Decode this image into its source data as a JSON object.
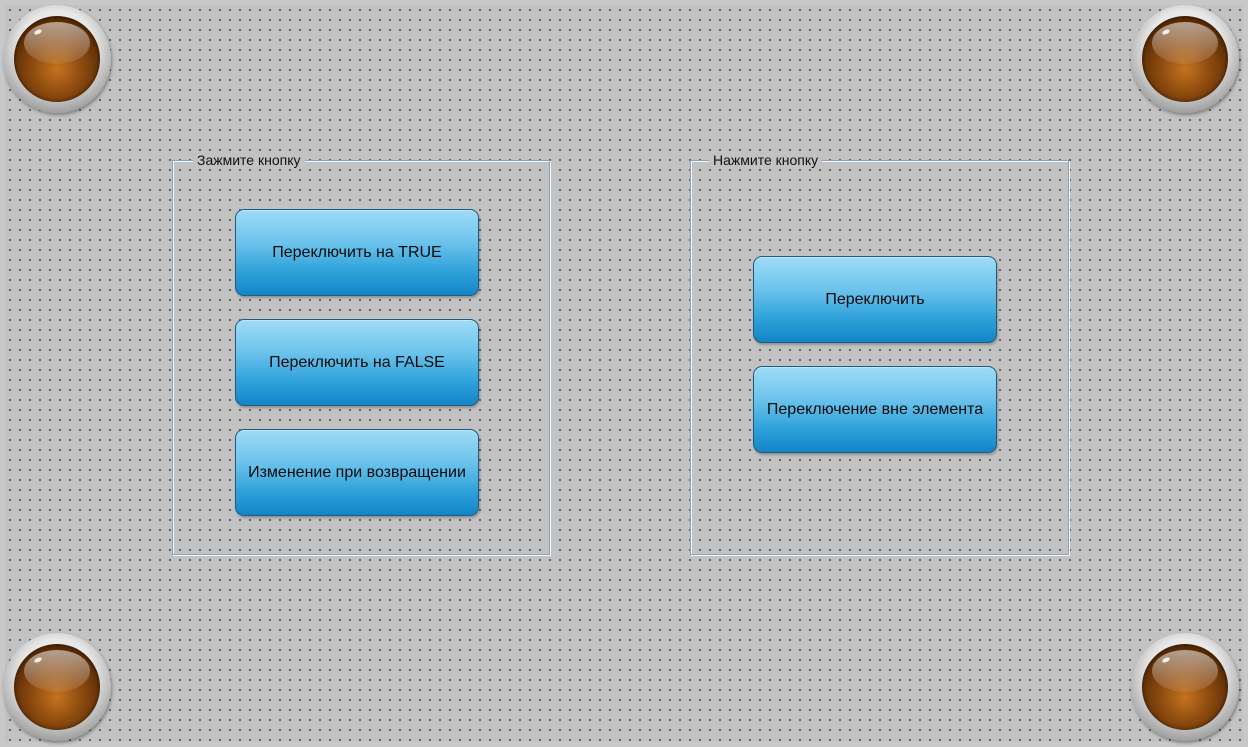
{
  "groups": {
    "left": {
      "title": "Зажмите кнопку",
      "buttons": [
        {
          "label": "Переключить на TRUE"
        },
        {
          "label": "Переключить на FALSE"
        },
        {
          "label": "Изменение при возвращении"
        }
      ]
    },
    "right": {
      "title": "Нажмите кнопку",
      "buttons": [
        {
          "label": "Переключить"
        },
        {
          "label": "Переключение вне элемента"
        }
      ]
    }
  },
  "lamps": [
    {
      "icon": "lamp-off-icon",
      "state": "off"
    },
    {
      "icon": "lamp-off-icon",
      "state": "off"
    },
    {
      "icon": "lamp-off-icon",
      "state": "off"
    },
    {
      "icon": "lamp-off-icon",
      "state": "off"
    }
  ],
  "colors": {
    "background": "#c2c2c2",
    "button_top": "#9fdcf6",
    "button_bottom": "#1285c8",
    "button_border": "#1f5a80",
    "lamp_off": "#8f4c10",
    "group_border": "#8ba4b8"
  }
}
